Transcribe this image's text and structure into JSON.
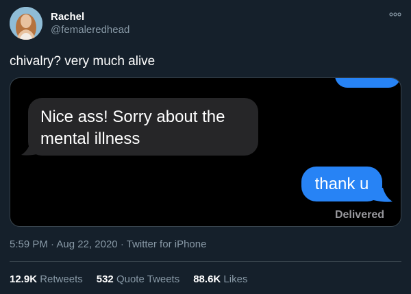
{
  "author": {
    "name": "Rachel",
    "handle": "@femaleredhead",
    "avatar_icon": "profile-photo"
  },
  "tweet": {
    "text": "chivalry? very much alive"
  },
  "media": {
    "messages": [
      {
        "direction": "incoming",
        "text": "Nice ass! Sorry about the mental illness"
      },
      {
        "direction": "outgoing",
        "text": "thank u"
      }
    ],
    "status": "Delivered",
    "colors": {
      "outgoing": "#2783f5",
      "incoming": "#262628",
      "background": "#000000"
    }
  },
  "meta": {
    "time": "5:59 PM",
    "date": "Aug 22, 2020",
    "source": "Twitter for iPhone",
    "separator": "·"
  },
  "stats": {
    "retweets_count": "12.9K",
    "retweets_label": "Retweets",
    "quotes_count": "532",
    "quotes_label": "Quote Tweets",
    "likes_count": "88.6K",
    "likes_label": "Likes"
  },
  "colors": {
    "background": "#15202b",
    "secondary_text": "#8899a6",
    "border": "#38444d"
  }
}
